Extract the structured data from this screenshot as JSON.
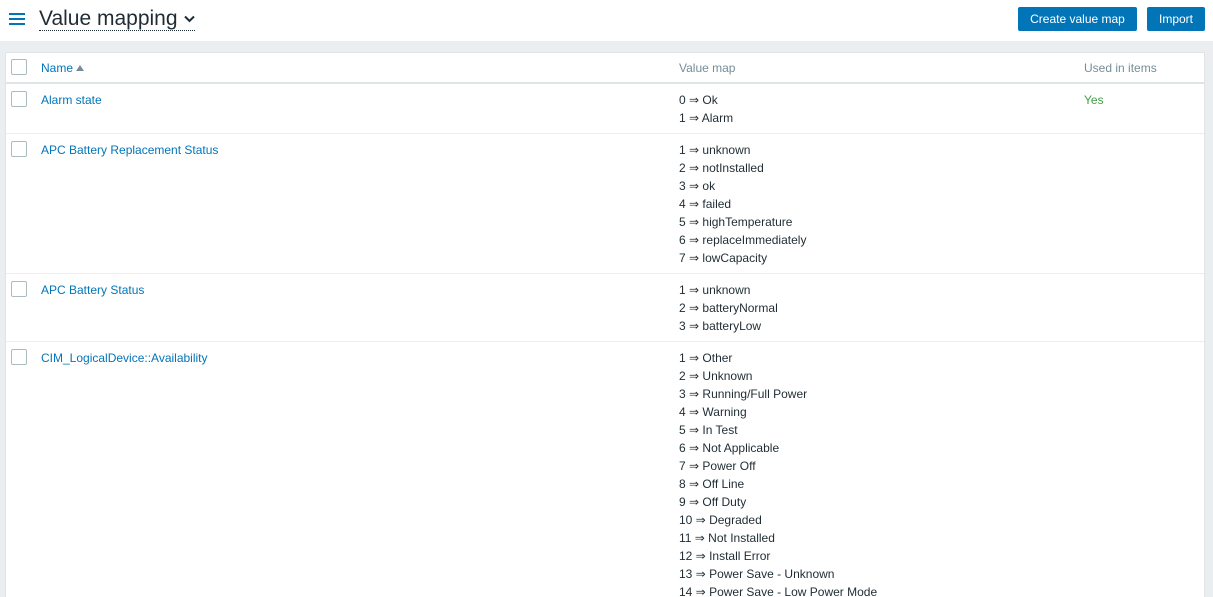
{
  "header": {
    "title": "Value mapping",
    "create_label": "Create value map",
    "import_label": "Import"
  },
  "table": {
    "columns": {
      "name": "Name",
      "value_map": "Value map",
      "used_in_items": "Used in items"
    },
    "sort": {
      "column": "Name",
      "direction": "ascending"
    },
    "rows": [
      {
        "name": "Alarm state",
        "mappings": [
          "0 ⇒ Ok",
          "1 ⇒ Alarm"
        ],
        "used": "Yes"
      },
      {
        "name": "APC Battery Replacement Status",
        "mappings": [
          "1 ⇒ unknown",
          "2 ⇒ notInstalled",
          "3 ⇒ ok",
          "4 ⇒ failed",
          "5 ⇒ highTemperature",
          "6 ⇒ replaceImmediately",
          "7 ⇒ lowCapacity"
        ],
        "used": ""
      },
      {
        "name": "APC Battery Status",
        "mappings": [
          "1 ⇒ unknown",
          "2 ⇒ batteryNormal",
          "3 ⇒ batteryLow"
        ],
        "used": ""
      },
      {
        "name": "CIM_LogicalDevice::Availability",
        "mappings": [
          "1 ⇒ Other",
          "2 ⇒ Unknown",
          "3 ⇒ Running/Full Power",
          "4 ⇒ Warning",
          "5 ⇒ In Test",
          "6 ⇒ Not Applicable",
          "7 ⇒ Power Off",
          "8 ⇒ Off Line",
          "9 ⇒ Off Duty",
          "10 ⇒ Degraded",
          "11 ⇒ Not Installed",
          "12 ⇒ Install Error",
          "13 ⇒ Power Save - Unknown",
          "14 ⇒ Power Save - Low Power Mode"
        ],
        "used": ""
      }
    ]
  },
  "colors": {
    "accent": "#0275b8",
    "used_yes": "#429e47",
    "background": "#ebeef0"
  },
  "icons": [
    "menu-icon",
    "chevron-down-icon",
    "sort-ascending-icon"
  ]
}
